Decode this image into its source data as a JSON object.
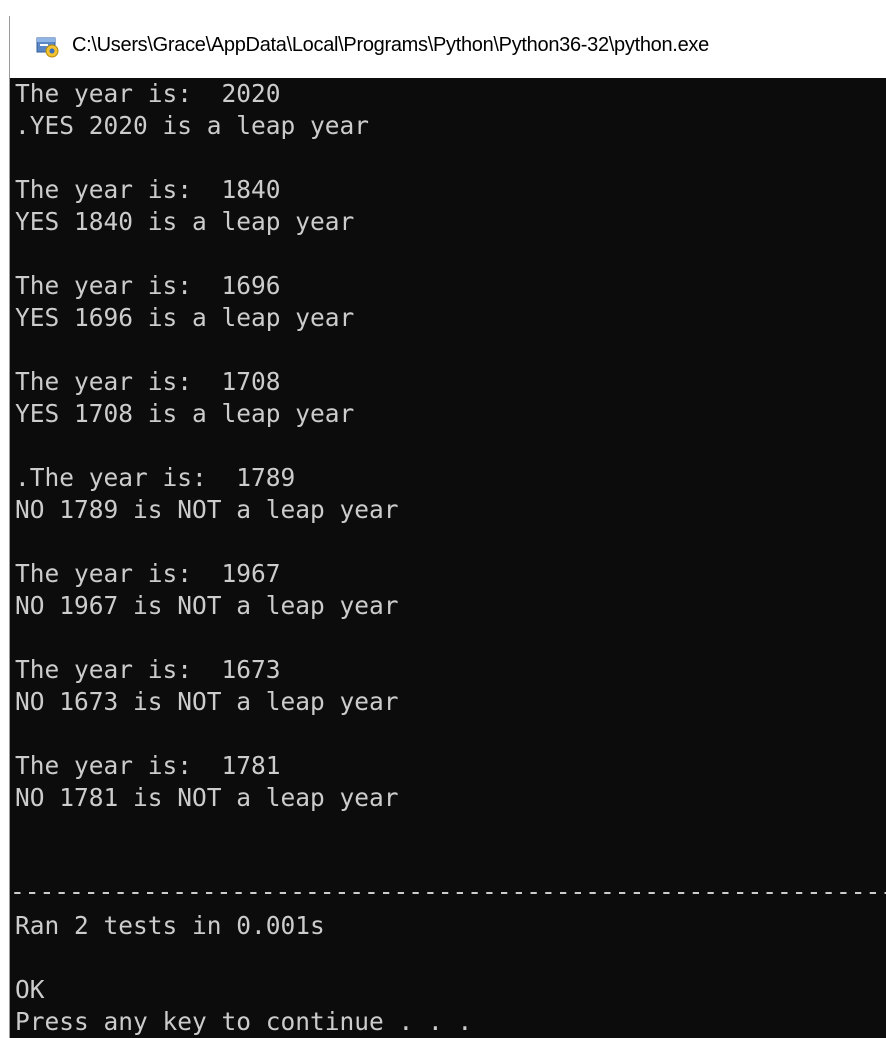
{
  "window": {
    "title": "C:\\Users\\Grace\\AppData\\Local\\Programs\\Python\\Python36-32\\python.exe",
    "icon": "python-console-icon"
  },
  "console": {
    "lines": [
      "The year is:  2020",
      ".YES 2020 is a leap year",
      "The year is:  1840",
      "YES 1840 is a leap year",
      "The year is:  1696",
      "YES 1696 is a leap year",
      "The year is:  1708",
      "YES 1708 is a leap year",
      ".The year is:  1789",
      "NO 1789 is NOT a leap year",
      "The year is:  1967",
      "NO 1967 is NOT a leap year",
      "The year is:  1673",
      "NO 1673 is NOT a leap year",
      "The year is:  1781",
      "NO 1781 is NOT a leap year",
      "----------------------------------------------------------------------",
      "Ran 2 tests in 0.001s",
      "OK",
      "Press any key to continue . . ."
    ]
  },
  "colors": {
    "console_bg": "#0c0c0c",
    "console_text": "#cccccc",
    "titlebar_bg": "#ffffff"
  }
}
